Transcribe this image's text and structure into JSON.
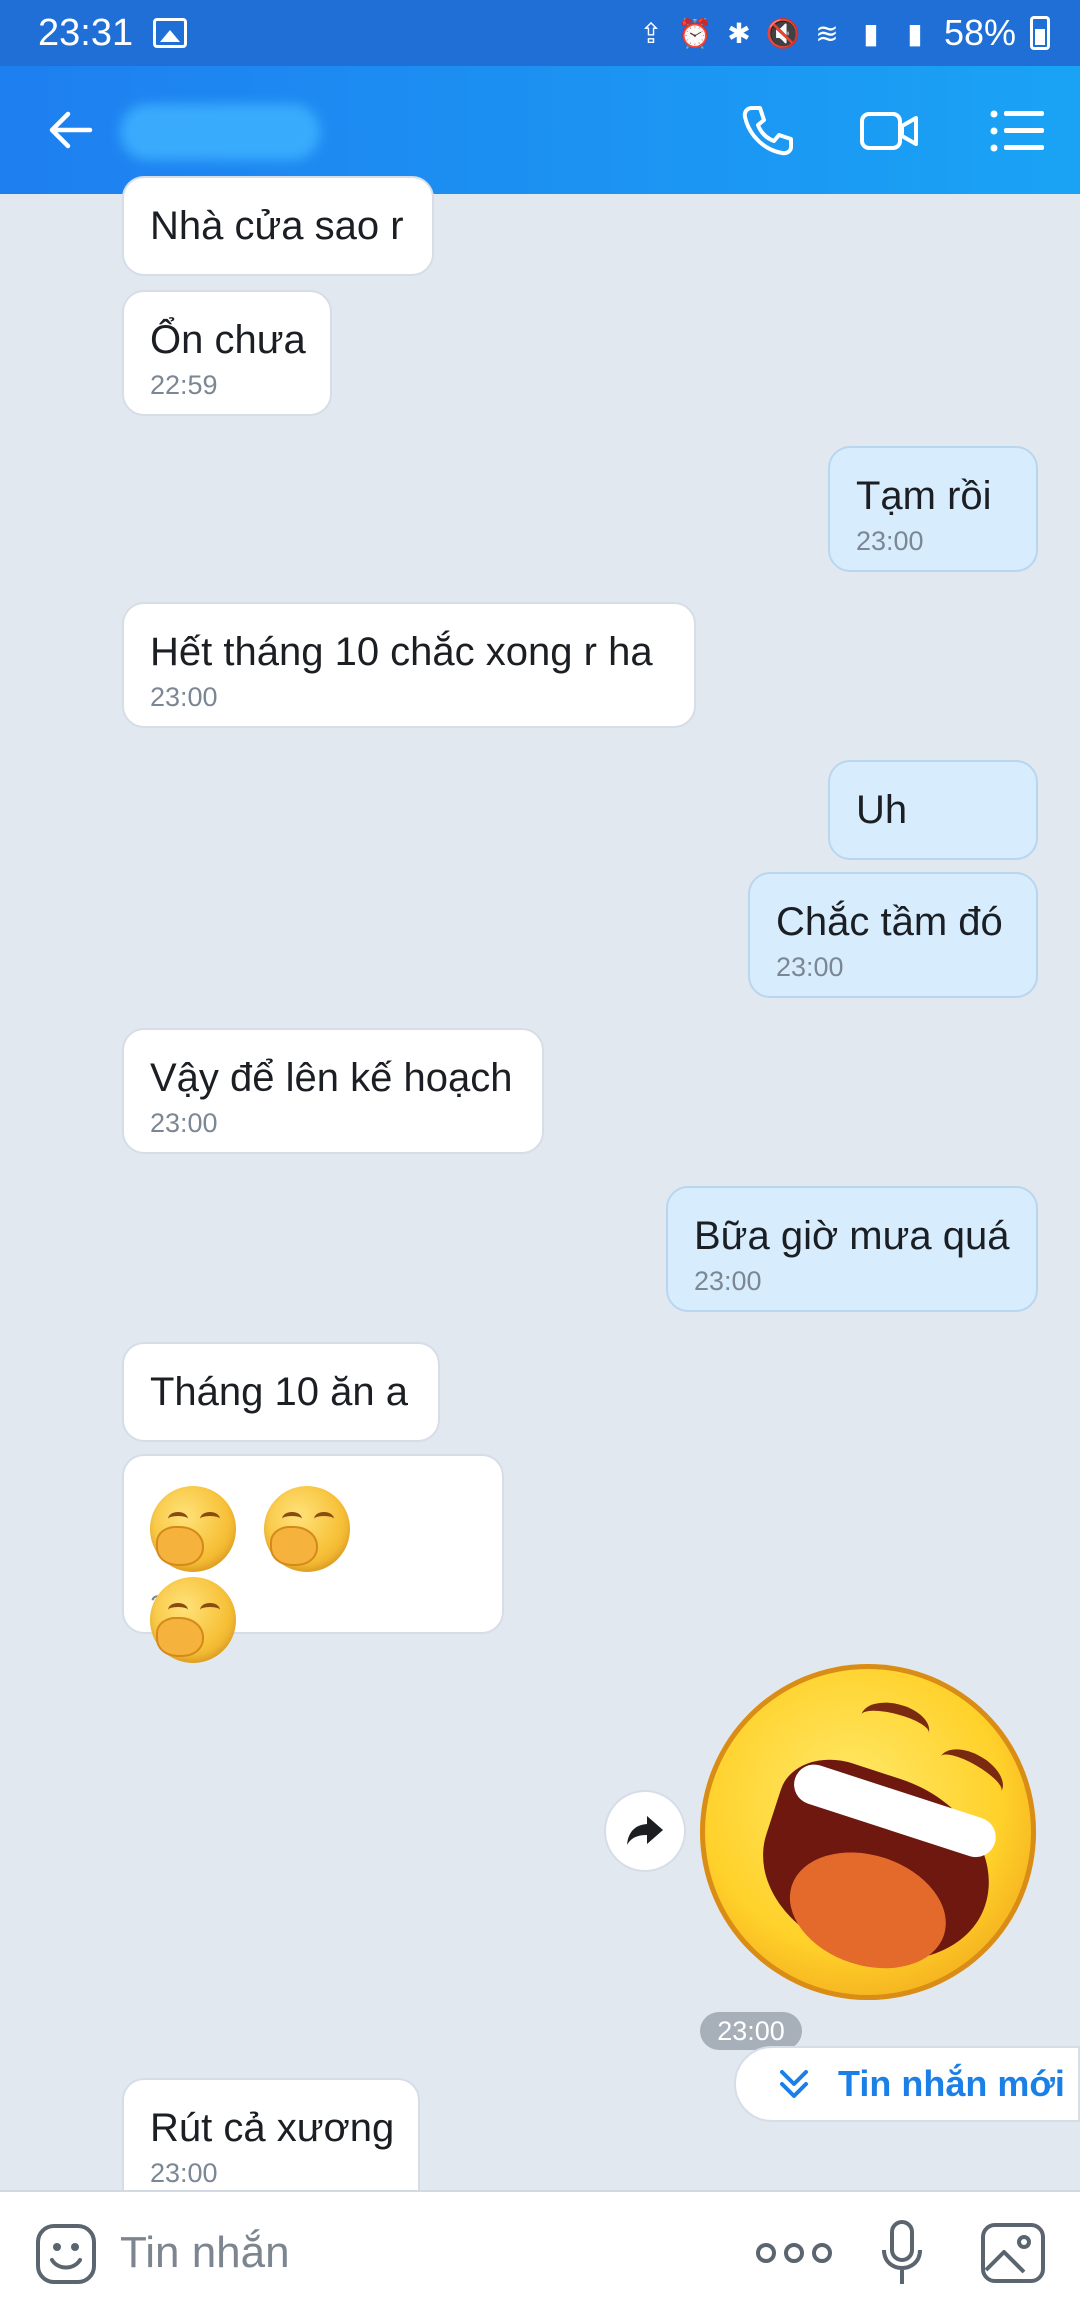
{
  "status_bar": {
    "time": "23:31",
    "battery": "58%"
  },
  "header": {
    "contact_name": ""
  },
  "messages": [
    {
      "text": "Nhà cửa sao r",
      "time": ""
    },
    {
      "text": "Ổn chưa",
      "time": "22:59"
    },
    {
      "text": "Tạm rồi",
      "time": "23:00"
    },
    {
      "text": "Hết tháng 10 chắc xong r ha",
      "time": "23:00"
    },
    {
      "text": "Uh",
      "time": ""
    },
    {
      "text": "Chắc tầm đó",
      "time": "23:00"
    },
    {
      "text": "Vậy để lên kế hoạch",
      "time": "23:00"
    },
    {
      "text": "Bữa giờ mưa quá",
      "time": "23:00"
    },
    {
      "text": "Tháng 10 ăn a",
      "time": ""
    },
    {
      "text": "",
      "time": "23:00"
    },
    {
      "text": "",
      "time": "23:00"
    },
    {
      "text": "Rút cả xương",
      "time": "23:00"
    }
  ],
  "new_message_button": {
    "label": "Tin nhắn mới"
  },
  "composer": {
    "placeholder": "Tin nhắn"
  }
}
